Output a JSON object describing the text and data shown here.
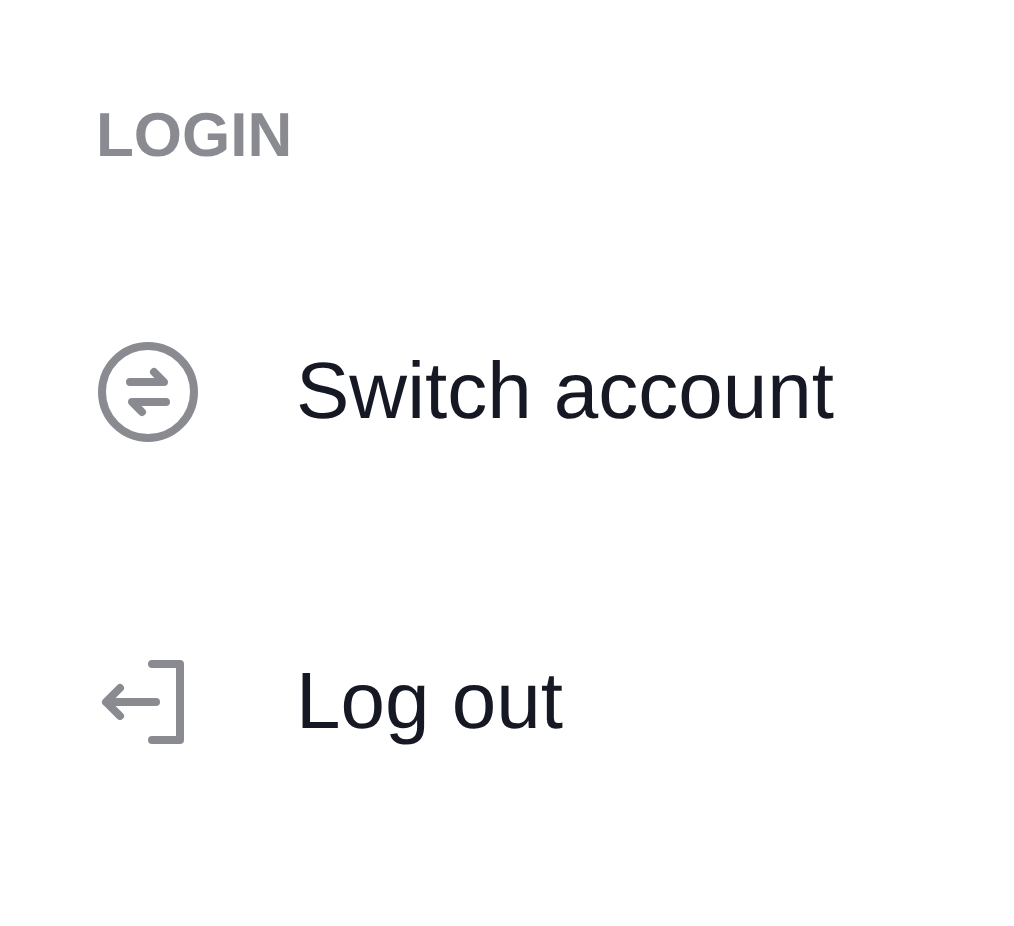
{
  "section": {
    "title": "LOGIN"
  },
  "items": [
    {
      "kind": "switch",
      "label": "Switch account"
    },
    {
      "kind": "logout",
      "label": "Log out"
    }
  ]
}
